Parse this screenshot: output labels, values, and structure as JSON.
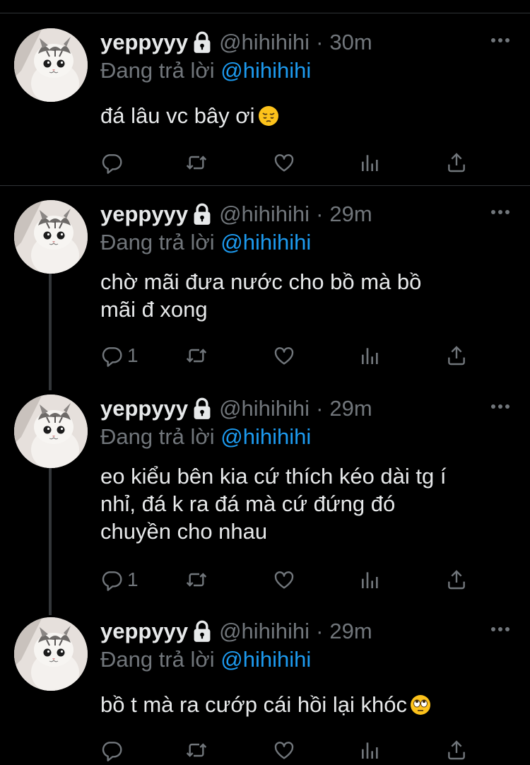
{
  "colors": {
    "background": "#000000",
    "text": "#e7e9ea",
    "secondary": "#71767b",
    "mention": "#1d9bf0",
    "divider": "#2f3336"
  },
  "tweets": [
    {
      "name": "yeppyyy",
      "handle": "@hihihihi",
      "dot": "·",
      "time": "30m",
      "reply_prefix": "Đang trả lời",
      "reply_mention": "@hihihihi",
      "text": "đá lâu vc bây ơi",
      "emoji": "pensive-face-icon",
      "reply_count": "",
      "icons": [
        "reply-icon",
        "retweet-icon",
        "like-icon",
        "analytics-icon",
        "share-icon"
      ]
    },
    {
      "name": "yeppyyy",
      "handle": "@hihihihi",
      "dot": "·",
      "time": "29m",
      "reply_prefix": "Đang trả lời",
      "reply_mention": "@hihihihi",
      "text": "chờ mãi đưa nước cho bồ mà bồ\nmãi đ xong",
      "emoji": "",
      "reply_count": "1",
      "icons": [
        "reply-icon",
        "retweet-icon",
        "like-icon",
        "analytics-icon",
        "share-icon"
      ]
    },
    {
      "name": "yeppyyy",
      "handle": "@hihihihi",
      "dot": "·",
      "time": "29m",
      "reply_prefix": "Đang trả lời",
      "reply_mention": "@hihihihi",
      "text": "eo kiểu bên kia cứ thích kéo dài tg í\nnhỉ, đá k ra đá mà cứ đứng đó\nchuyền cho nhau",
      "emoji": "",
      "reply_count": "1",
      "icons": [
        "reply-icon",
        "retweet-icon",
        "like-icon",
        "analytics-icon",
        "share-icon"
      ]
    },
    {
      "name": "yeppyyy",
      "handle": "@hihihihi",
      "dot": "·",
      "time": "29m",
      "reply_prefix": "Đang trả lời",
      "reply_mention": "@hihihihi",
      "text": "bồ t mà ra cướp cái hồi lại khóc",
      "emoji": "rolling-eyes-icon",
      "reply_count": "",
      "icons": [
        "reply-icon",
        "retweet-icon",
        "like-icon",
        "analytics-icon",
        "share-icon"
      ]
    }
  ]
}
